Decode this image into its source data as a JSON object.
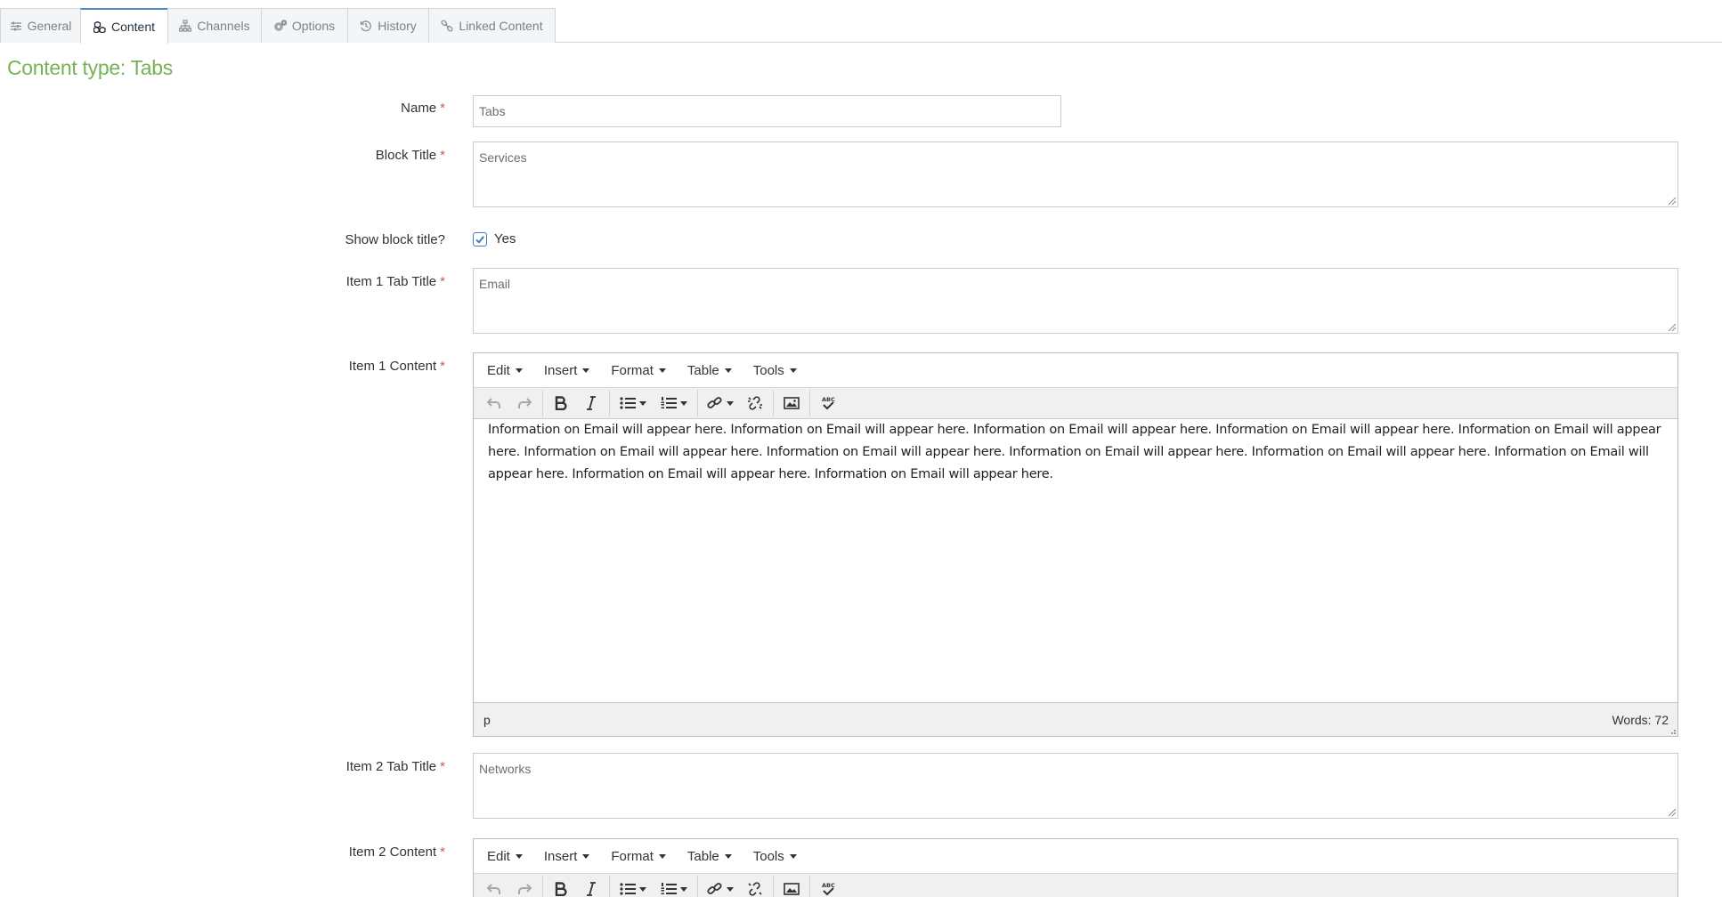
{
  "tabs": [
    {
      "label": "General",
      "icon": "sliders-icon"
    },
    {
      "label": "Content",
      "icon": "cubes-icon",
      "active": true
    },
    {
      "label": "Channels",
      "icon": "sitemap-icon"
    },
    {
      "label": "Options",
      "icon": "cogs-icon"
    },
    {
      "label": "History",
      "icon": "history-icon"
    },
    {
      "label": "Linked Content",
      "icon": "link-icon"
    }
  ],
  "content_type_heading": "Content type: Tabs",
  "colors": {
    "heading_green": "#77b255",
    "required_red": "#d9534f",
    "active_tab_border": "#4a8bc2"
  },
  "form": {
    "name": {
      "label": "Name",
      "value": "Tabs"
    },
    "block_title": {
      "label": "Block Title",
      "value": "Services"
    },
    "show_block_title": {
      "label": "Show block title?",
      "checkbox_label": "Yes",
      "checked": true
    },
    "item1_tab_title": {
      "label": "Item 1 Tab Title",
      "value": "Email"
    },
    "item1_content": {
      "label": "Item 1 Content",
      "body": "Information on Email will appear here. Information on Email will appear here. Information on Email will appear here. Information on Email will appear here. Information on Email will appear here. Information on Email will appear here. Information on Email will appear here. Information on Email will appear here. Information on Email will appear here. Information on Email will appear here. Information on Email will appear here. Information on Email will appear here.",
      "path": "p",
      "word_count": "Words: 72"
    },
    "item2_tab_title": {
      "label": "Item 2 Tab Title",
      "value": "Networks"
    },
    "item2_content": {
      "label": "Item 2 Content"
    }
  },
  "editor_menu": [
    "Edit",
    "Insert",
    "Format",
    "Table",
    "Tools"
  ],
  "required_marker": "*"
}
